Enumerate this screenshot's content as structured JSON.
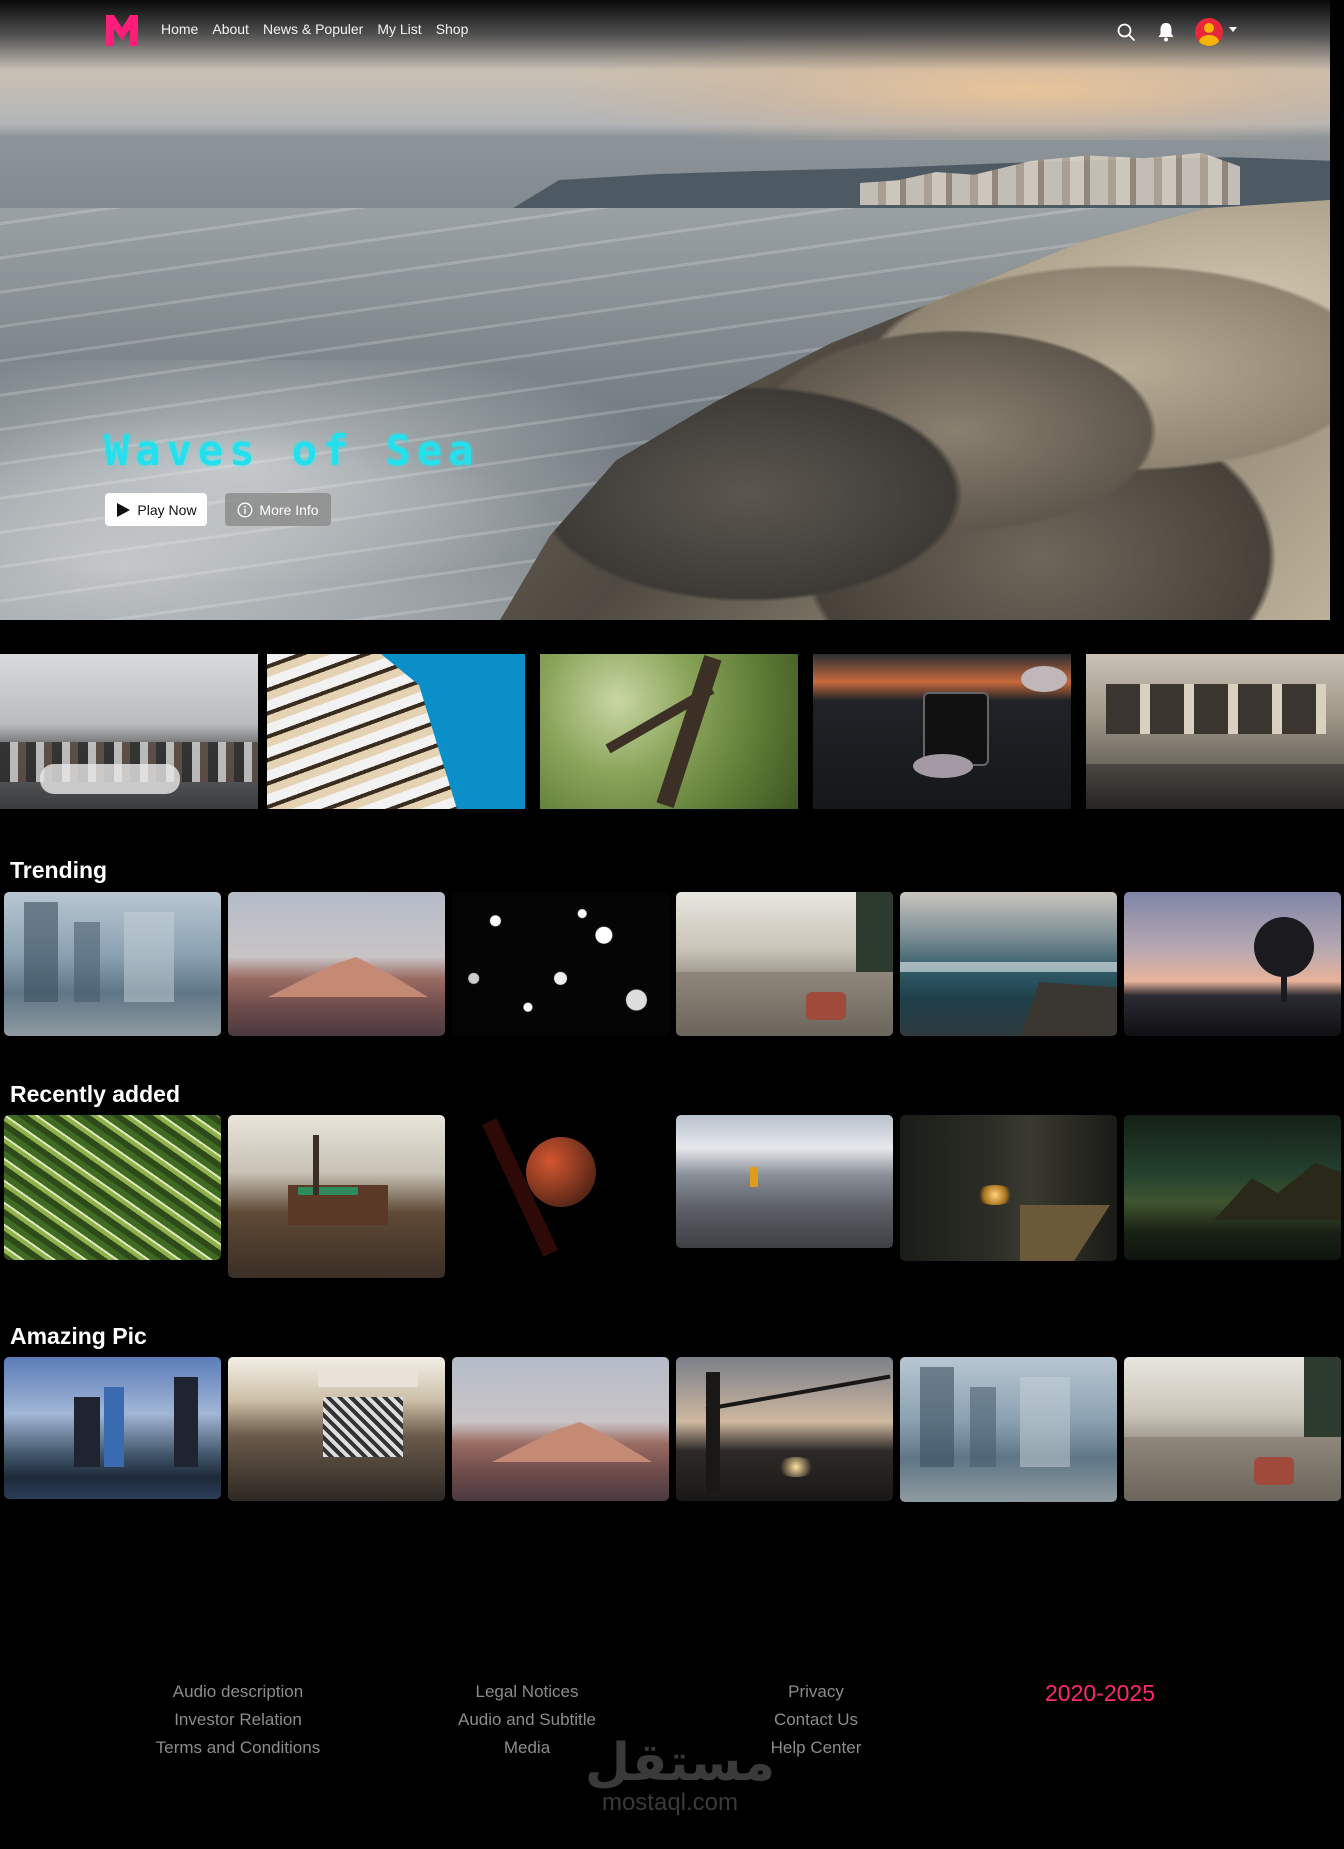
{
  "nav": {
    "logo": "M",
    "links": [
      "Home",
      "About",
      "News & Populer",
      "My List",
      "Shop"
    ]
  },
  "hero": {
    "title": "Waves of Sea",
    "play_label": "Play Now",
    "info_label": "More Info"
  },
  "rows": [
    {
      "title": "Trending"
    },
    {
      "title": "Recently added"
    },
    {
      "title": "Amazing Pic"
    }
  ],
  "footer": {
    "col1": [
      "Audio description",
      "Investor Relation",
      "Terms and Conditions"
    ],
    "col2": [
      "Legal Notices",
      "Audio and Subtitle",
      "Media"
    ],
    "col3": [
      "Privacy",
      "Contact Us",
      "Help Center"
    ],
    "years": "2020-2025"
  },
  "watermark": {
    "arabic": "مستقل",
    "latin": "mostaql.com"
  },
  "colors": {
    "brand": "#ff2a6d",
    "logo": "#ff1d7a",
    "hero_title": "#22e0ee",
    "footer_text": "#8c8c8c"
  }
}
